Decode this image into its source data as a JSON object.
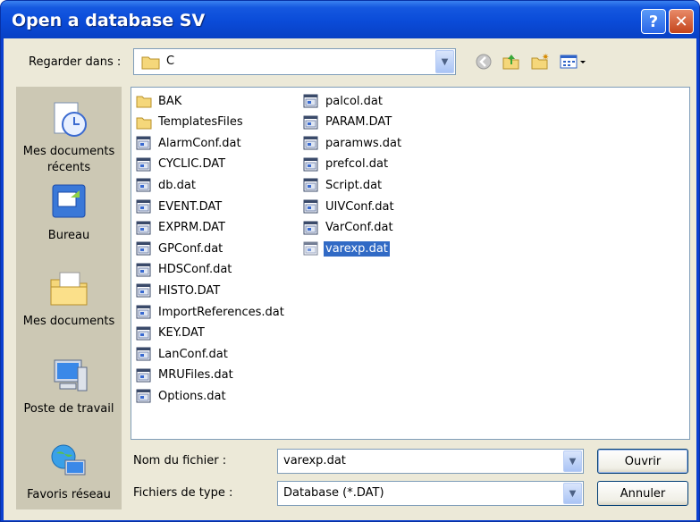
{
  "window": {
    "title": "Open a database SV",
    "help_label": "?",
    "close_label": "✕"
  },
  "lookin": {
    "label": "Regarder dans :",
    "value": "C"
  },
  "places": [
    {
      "label": "Mes documents récents",
      "icon": "recent-documents-icon"
    },
    {
      "label": "Bureau",
      "icon": "desktop-icon"
    },
    {
      "label": "Mes documents",
      "icon": "my-documents-icon"
    },
    {
      "label": "Poste de travail",
      "icon": "my-computer-icon"
    },
    {
      "label": "Favoris réseau",
      "icon": "network-places-icon"
    }
  ],
  "files_col1": [
    {
      "name": "BAK",
      "type": "folder"
    },
    {
      "name": "TemplatesFiles",
      "type": "folder"
    },
    {
      "name": "AlarmConf.dat",
      "type": "file"
    },
    {
      "name": "CYCLIC.DAT",
      "type": "file"
    },
    {
      "name": "db.dat",
      "type": "file"
    },
    {
      "name": "EVENT.DAT",
      "type": "file"
    },
    {
      "name": "EXPRM.DAT",
      "type": "file"
    },
    {
      "name": "GPConf.dat",
      "type": "file"
    },
    {
      "name": "HDSConf.dat",
      "type": "file"
    },
    {
      "name": "HISTO.DAT",
      "type": "file"
    },
    {
      "name": "ImportReferences.dat",
      "type": "file"
    },
    {
      "name": "KEY.DAT",
      "type": "file"
    },
    {
      "name": "LanConf.dat",
      "type": "file"
    },
    {
      "name": "MRUFiles.dat",
      "type": "file"
    },
    {
      "name": "Options.dat",
      "type": "file"
    }
  ],
  "files_col2": [
    {
      "name": "palcol.dat",
      "type": "file"
    },
    {
      "name": "PARAM.DAT",
      "type": "file"
    },
    {
      "name": "paramws.dat",
      "type": "file"
    },
    {
      "name": "prefcol.dat",
      "type": "file"
    },
    {
      "name": "Script.dat",
      "type": "file"
    },
    {
      "name": "UIVConf.dat",
      "type": "file"
    },
    {
      "name": "VarConf.dat",
      "type": "file"
    },
    {
      "name": "varexp.dat",
      "type": "file",
      "selected": true
    }
  ],
  "filename": {
    "label": "Nom du fichier :",
    "value": "varexp.dat"
  },
  "filetype": {
    "label": "Fichiers de type :",
    "value": "Database (*.DAT)"
  },
  "buttons": {
    "open": "Ouvrir",
    "cancel": "Annuler"
  }
}
